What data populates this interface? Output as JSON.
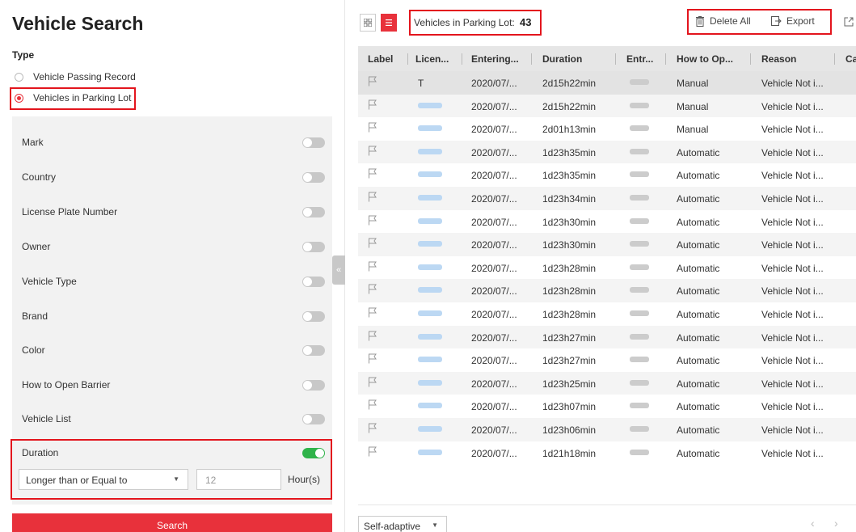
{
  "search_panel": {
    "title": "Vehicle Search",
    "type_label": "Type",
    "type_options": [
      {
        "label": "Vehicle Passing Record",
        "selected": false
      },
      {
        "label": "Vehicles in Parking Lot",
        "selected": true
      }
    ],
    "filters": [
      {
        "label": "Mark",
        "enabled": false
      },
      {
        "label": "Country",
        "enabled": false
      },
      {
        "label": "License Plate Number",
        "enabled": false
      },
      {
        "label": "Owner",
        "enabled": false
      },
      {
        "label": "Vehicle Type",
        "enabled": false
      },
      {
        "label": "Brand",
        "enabled": false
      },
      {
        "label": "Color",
        "enabled": false
      },
      {
        "label": "How to Open Barrier",
        "enabled": false
      },
      {
        "label": "Vehicle List",
        "enabled": false
      },
      {
        "label": "Duration",
        "enabled": true
      }
    ],
    "duration": {
      "condition": "Longer than or Equal to",
      "value": "12",
      "unit": "Hour(s)"
    },
    "search_label": "Search",
    "collapse_glyph": "«"
  },
  "results": {
    "count_label": "Vehicles in Parking Lot:",
    "count_value": "43",
    "delete_all_label": "Delete All",
    "export_label": "Export",
    "columns": [
      "Label",
      "Licen...",
      "Entering...",
      "Duration",
      "Entr...",
      "How to Op...",
      "Reason",
      "Ca"
    ],
    "rows": [
      {
        "plate": "T",
        "entering": "2020/07/...",
        "duration": "2d15h22min",
        "open": "Manual",
        "reason": "Vehicle Not i..."
      },
      {
        "plate": "",
        "entering": "2020/07/...",
        "duration": "2d15h22min",
        "open": "Manual",
        "reason": "Vehicle Not i..."
      },
      {
        "plate": "",
        "entering": "2020/07/...",
        "duration": "2d01h13min",
        "open": "Manual",
        "reason": "Vehicle Not i..."
      },
      {
        "plate": "",
        "entering": "2020/07/...",
        "duration": "1d23h35min",
        "open": "Automatic",
        "reason": "Vehicle Not i..."
      },
      {
        "plate": "",
        "entering": "2020/07/...",
        "duration": "1d23h35min",
        "open": "Automatic",
        "reason": "Vehicle Not i..."
      },
      {
        "plate": "",
        "entering": "2020/07/...",
        "duration": "1d23h34min",
        "open": "Automatic",
        "reason": "Vehicle Not i..."
      },
      {
        "plate": "",
        "entering": "2020/07/...",
        "duration": "1d23h30min",
        "open": "Automatic",
        "reason": "Vehicle Not i..."
      },
      {
        "plate": "",
        "entering": "2020/07/...",
        "duration": "1d23h30min",
        "open": "Automatic",
        "reason": "Vehicle Not i..."
      },
      {
        "plate": "",
        "entering": "2020/07/...",
        "duration": "1d23h28min",
        "open": "Automatic",
        "reason": "Vehicle Not i..."
      },
      {
        "plate": "",
        "entering": "2020/07/...",
        "duration": "1d23h28min",
        "open": "Automatic",
        "reason": "Vehicle Not i..."
      },
      {
        "plate": "",
        "entering": "2020/07/...",
        "duration": "1d23h28min",
        "open": "Automatic",
        "reason": "Vehicle Not i..."
      },
      {
        "plate": "",
        "entering": "2020/07/...",
        "duration": "1d23h27min",
        "open": "Automatic",
        "reason": "Vehicle Not i..."
      },
      {
        "plate": "",
        "entering": "2020/07/...",
        "duration": "1d23h27min",
        "open": "Automatic",
        "reason": "Vehicle Not i..."
      },
      {
        "plate": "",
        "entering": "2020/07/...",
        "duration": "1d23h25min",
        "open": "Automatic",
        "reason": "Vehicle Not i..."
      },
      {
        "plate": "",
        "entering": "2020/07/...",
        "duration": "1d23h07min",
        "open": "Automatic",
        "reason": "Vehicle Not i..."
      },
      {
        "plate": "",
        "entering": "2020/07/...",
        "duration": "1d23h06min",
        "open": "Automatic",
        "reason": "Vehicle Not i..."
      },
      {
        "plate": "",
        "entering": "2020/07/...",
        "duration": "1d21h18min",
        "open": "Automatic",
        "reason": "Vehicle Not i..."
      }
    ],
    "page_size": "Self-adaptive",
    "prev_glyph": "‹",
    "next_glyph": "›"
  },
  "icons": {
    "grid_view": "grid-view-icon",
    "list_view": "list-view-icon",
    "delete_all": "trash-icon",
    "export": "export-icon",
    "popout": "popout-icon",
    "flag": "flag-icon"
  },
  "colors": {
    "accent": "#e8313b",
    "toggle_on": "#2fb34a",
    "highlight_box": "#e3151d"
  }
}
